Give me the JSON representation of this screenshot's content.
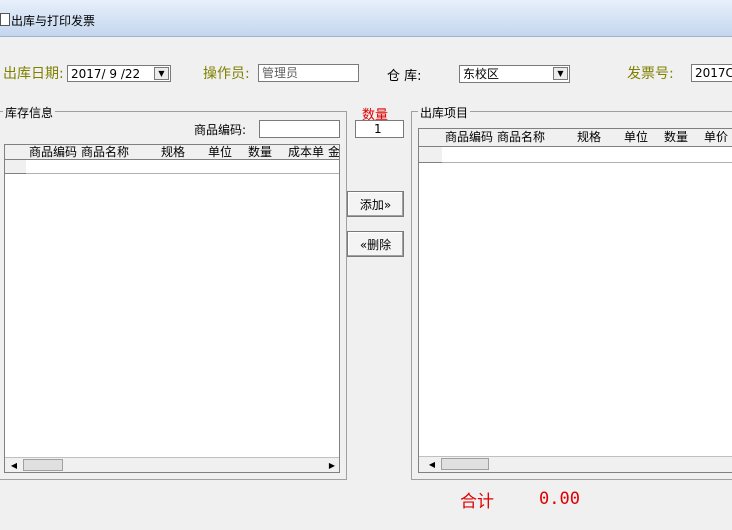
{
  "window": {
    "title": "出库与打印发票"
  },
  "header": {
    "date_label": "出库日期:",
    "date_value": "2017/ 9 /22",
    "operator_label": "操作员:",
    "operator_value": "管理员",
    "warehouse_label": "仓  库:",
    "warehouse_value": "东校区",
    "invoice_label": "发票号:",
    "invoice_value": "2017C"
  },
  "inventory": {
    "group_label": "库存信息",
    "code_label": "商品编码:",
    "code_value": "",
    "columns": [
      "商品编码",
      "商品名称",
      "规格",
      "单位",
      "数量",
      "成本单",
      "金"
    ]
  },
  "middle": {
    "qty_label": "数量",
    "qty_value": "1",
    "add_label": "添加»",
    "delete_label": "«删除"
  },
  "outbound": {
    "group_label": "出库项目",
    "columns": [
      "商品编码",
      "商品名称",
      "规格",
      "单位",
      "数量",
      "单价"
    ]
  },
  "footer": {
    "total_label": "合计",
    "total_value": "0.00"
  },
  "colors": {
    "accent_red": "#e00000",
    "label_olive": "#808000",
    "titlebar": "#c4d6ee"
  }
}
